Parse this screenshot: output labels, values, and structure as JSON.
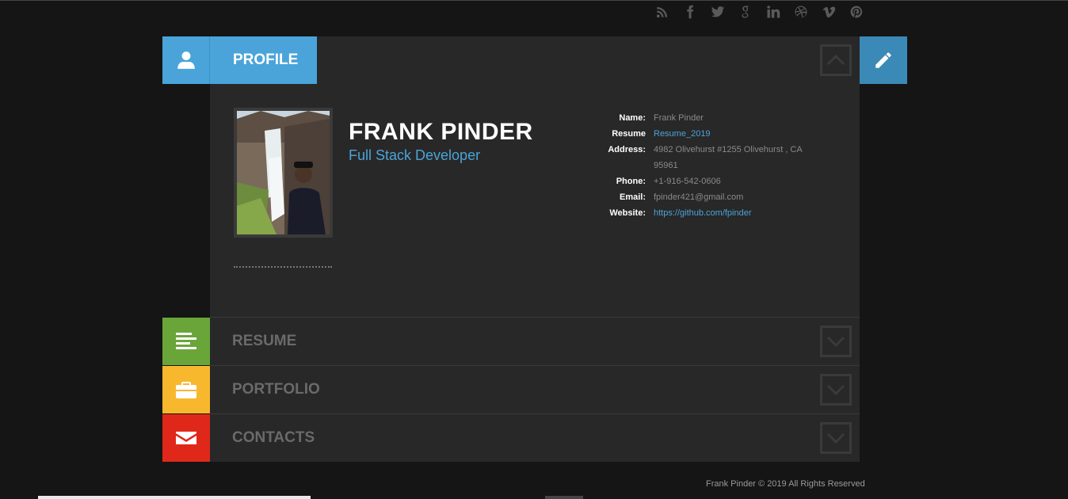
{
  "social": [
    "rss-icon",
    "facebook-icon",
    "twitter-icon",
    "google-plus-icon",
    "linkedin-icon",
    "dribbble-icon",
    "vimeo-icon",
    "pinterest-icon"
  ],
  "profile": {
    "tab_label": "PROFILE",
    "name": "FRANK PINDER",
    "role": "Full Stack Developer",
    "info": [
      {
        "key": "Name:",
        "value": "Frank Pinder",
        "link": false
      },
      {
        "key": "Resume",
        "value": "Resume_2019",
        "link": true
      },
      {
        "key": "Address:",
        "value": "4982 Olivehurst #1255 Olivehurst , CA 95961",
        "link": false
      },
      {
        "key": "Phone:",
        "value": "+1-916-542-0606",
        "link": false
      },
      {
        "key": "Email:",
        "value": "fpinder421@gmail.com",
        "link": false
      },
      {
        "key": "Website:",
        "value": "https://github.com/fpinder",
        "link": true
      }
    ]
  },
  "sections": [
    {
      "label": "RESUME",
      "color": "#6aa53a",
      "icon": "list-icon"
    },
    {
      "label": "PORTFOLIO",
      "color": "#f8b82e",
      "icon": "briefcase-icon"
    },
    {
      "label": "CONTACTS",
      "color": "#e0281a",
      "icon": "envelope-icon"
    }
  ],
  "colors": {
    "accent": "#4aa4d9",
    "edit": "#3b89b6",
    "background": "#151515",
    "panel": "#282828"
  },
  "footer": "Frank Pinder © 2019 All Rights Reserved"
}
